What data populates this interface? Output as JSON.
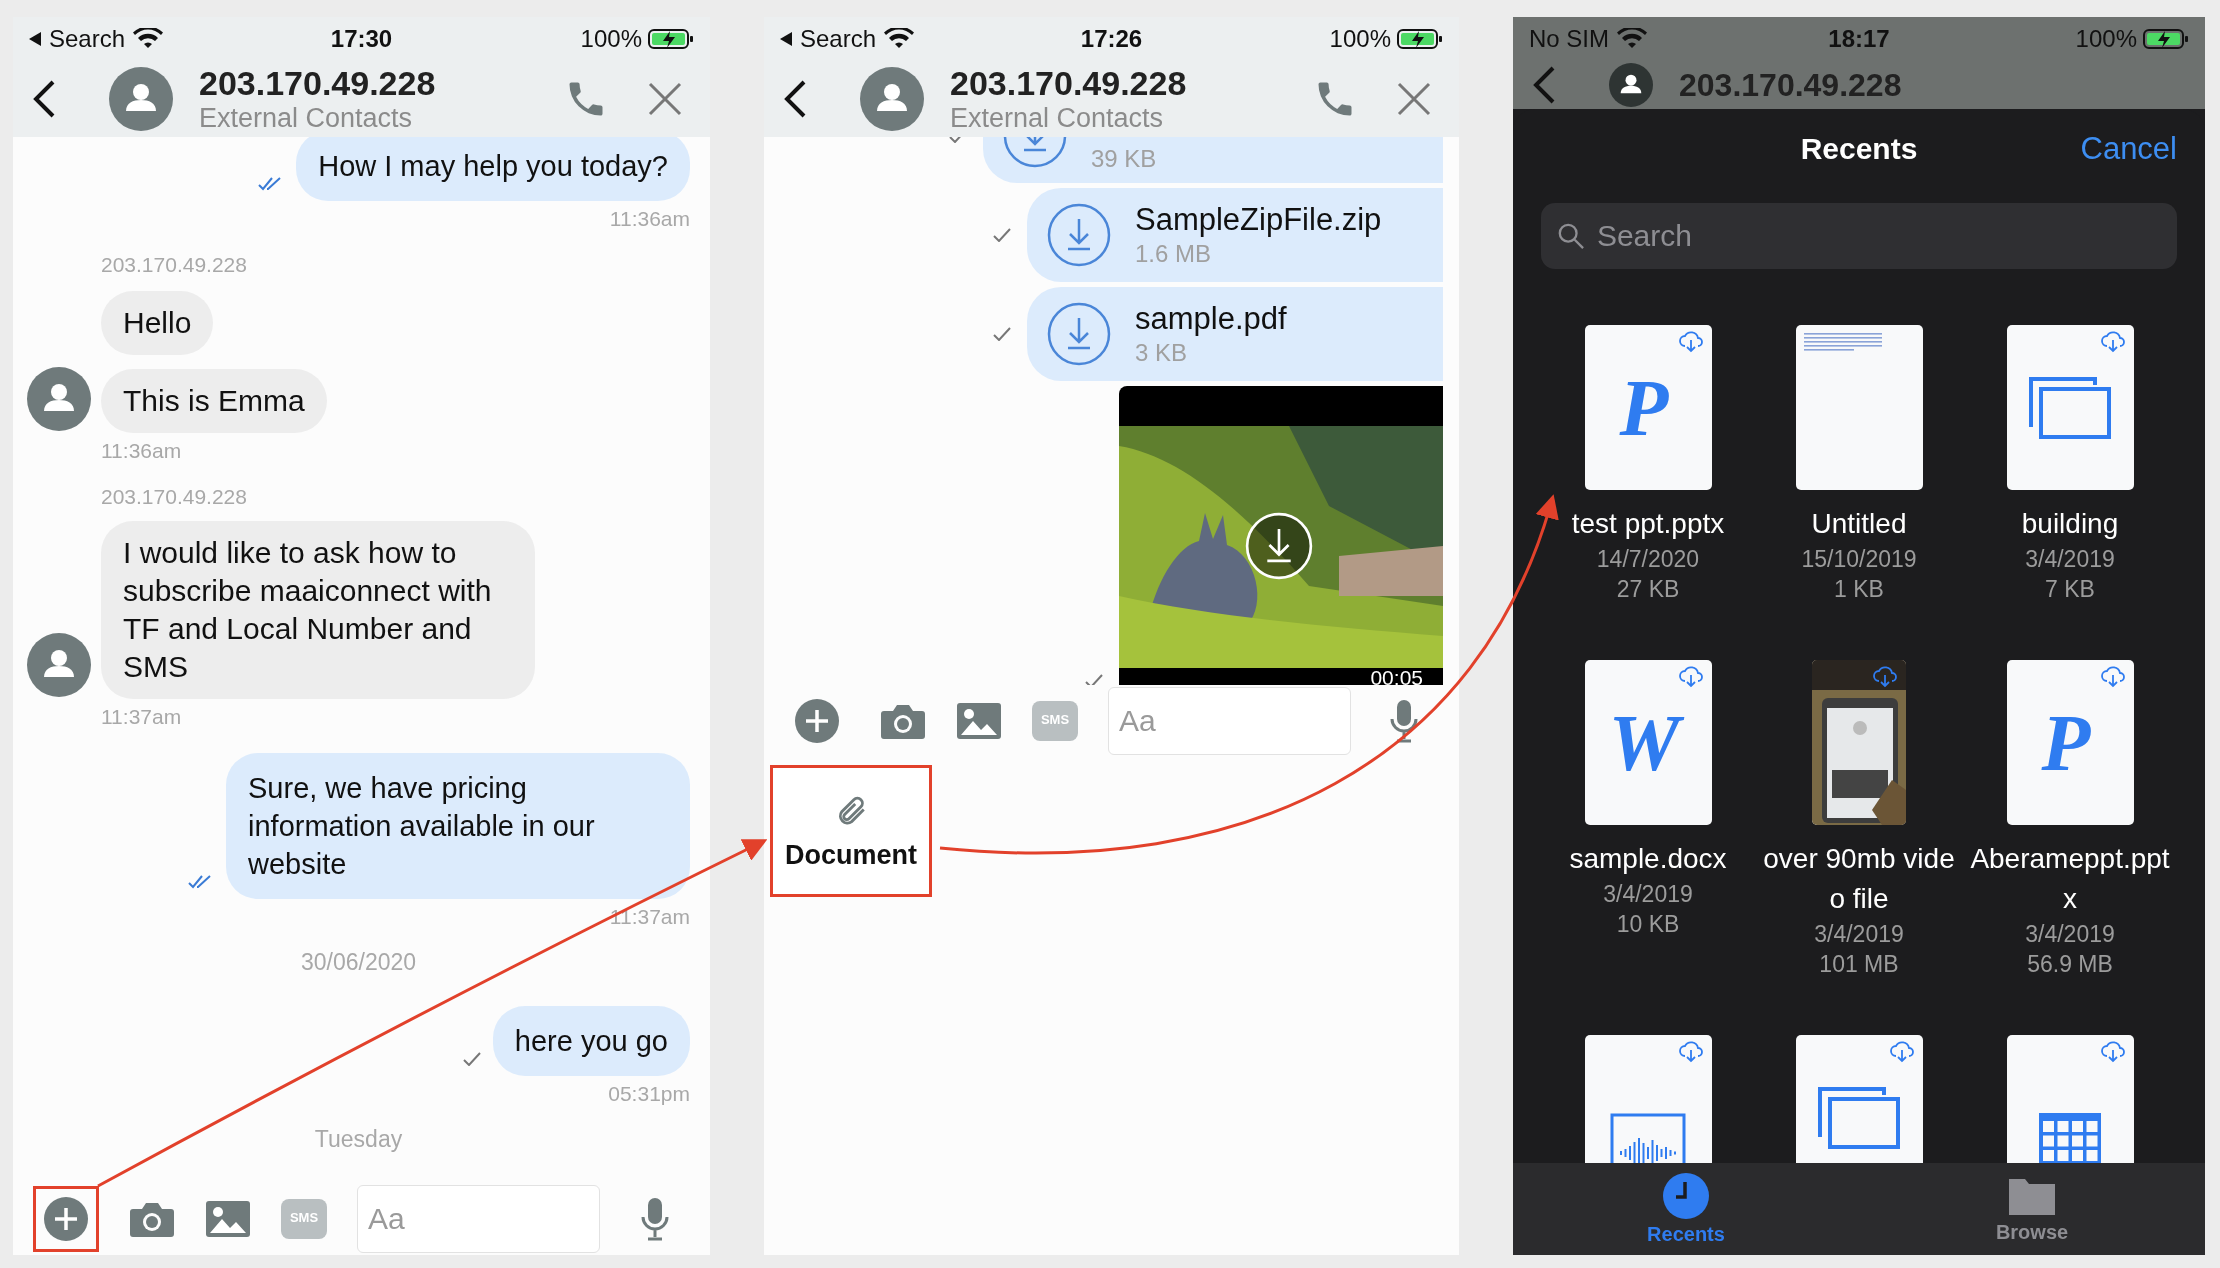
{
  "phones": [
    {
      "kind": "chat",
      "status": {
        "back_label": "Search",
        "time": "17:30",
        "battery": "100%"
      },
      "header": {
        "title": "203.170.49.228",
        "subtitle": "External Contacts"
      },
      "messages": [
        {
          "kind": "outgoing",
          "text": "How I may help you today?",
          "read": true,
          "time": "11:36am"
        },
        {
          "kind": "sender",
          "text": "203.170.49.228"
        },
        {
          "kind": "incoming",
          "text": "Hello",
          "avatar": false
        },
        {
          "kind": "incoming",
          "text": "This is Emma",
          "avatar": true,
          "time": "11:36am"
        },
        {
          "kind": "sender",
          "text": "203.170.49.228"
        },
        {
          "kind": "incoming",
          "text": "I would like to ask how to subscribe maaiconnect with TF and Local Number and SMS",
          "avatar": true,
          "time": "11:37am"
        },
        {
          "kind": "outgoing",
          "text": "Sure, we have pricing information available in our website",
          "read": true,
          "time": "11:37am"
        },
        {
          "kind": "date",
          "text": "30/06/2020"
        },
        {
          "kind": "outgoing",
          "text": "here you go",
          "read": false,
          "time": "05:31pm"
        },
        {
          "kind": "date",
          "text": "Tuesday"
        }
      ],
      "composer": {
        "placeholder": "Aa",
        "sms_label": "SMS",
        "plus_highlighted": true
      }
    },
    {
      "kind": "chat",
      "status": {
        "back_label": "Search",
        "time": "17:26",
        "battery": "100%"
      },
      "header": {
        "title": "203.170.49.228",
        "subtitle": "External Contacts"
      },
      "messages": [
        {
          "kind": "file",
          "size": "39 KB",
          "read": false
        },
        {
          "kind": "file",
          "name": "SampleZipFile.zip",
          "size": "1.6 MB",
          "read": false
        },
        {
          "kind": "file",
          "name": "sample.pdf",
          "size": "3 KB",
          "read": false
        },
        {
          "kind": "video",
          "duration": "00:05",
          "read": false
        }
      ],
      "composer": {
        "placeholder": "Aa",
        "sms_label": "SMS",
        "plus_highlighted": false
      },
      "attach_options": [
        {
          "label": "Document",
          "highlighted": true
        }
      ]
    },
    {
      "kind": "picker",
      "status": {
        "carrier": "No SIM",
        "time": "18:17",
        "battery": "100%"
      },
      "header": {
        "title": "203.170.49.228"
      },
      "sheet": {
        "title": "Recents",
        "cancel": "Cancel",
        "search_placeholder": "Search",
        "files": [
          {
            "kind": "letter",
            "glyph": "P",
            "name": "test ppt.pptx",
            "date": "14/7/2020",
            "size": "27 KB",
            "cloud": true
          },
          {
            "kind": "text",
            "name": "Untitled",
            "date": "15/10/2019",
            "size": "1 KB",
            "cloud": false
          },
          {
            "kind": "slides",
            "name": "building",
            "date": "3/4/2019",
            "size": "7 KB",
            "cloud": true
          },
          {
            "kind": "letter",
            "glyph": "W",
            "name": "sample.docx",
            "date": "3/4/2019",
            "size": "10 KB",
            "cloud": true
          },
          {
            "name": "over 90mb video file",
            "date": "3/4/2019",
            "size": "101 MB",
            "cloud": true
          },
          {
            "kind": "letter",
            "glyph": "P",
            "name": "Aberameppt.pptx",
            "date": "3/4/2019",
            "size": "56.9 MB",
            "cloud": true
          },
          {
            "kind": "audio",
            "cloud": true
          },
          {
            "kind": "slides",
            "cloud": true
          },
          {
            "kind": "sheet",
            "cloud": true
          }
        ],
        "tabs": [
          {
            "kind": "clock",
            "label": "Recents",
            "selected": true
          },
          {
            "kind": "folder",
            "label": "Browse",
            "selected": false
          }
        ]
      }
    }
  ]
}
